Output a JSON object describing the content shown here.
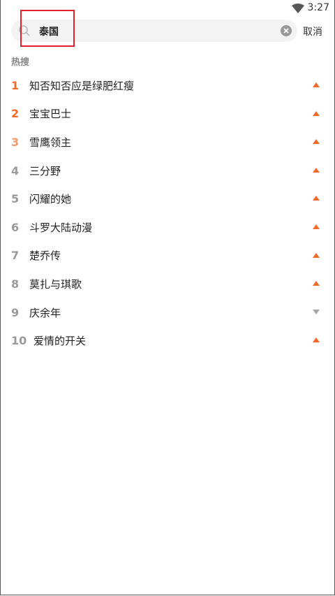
{
  "status": {
    "time": "3:27"
  },
  "search": {
    "value": "泰国",
    "cancel_label": "取消"
  },
  "hot": {
    "title": "热搜",
    "items": [
      {
        "rank": "1",
        "title": "知否知否应是绿肥红瘦",
        "trend": "up"
      },
      {
        "rank": "2",
        "title": "宝宝巴士",
        "trend": "up"
      },
      {
        "rank": "3",
        "title": "雪鹰领主",
        "trend": "up"
      },
      {
        "rank": "4",
        "title": "三分野",
        "trend": "up"
      },
      {
        "rank": "5",
        "title": "闪耀的她",
        "trend": "up"
      },
      {
        "rank": "6",
        "title": "斗罗大陆动漫",
        "trend": "up"
      },
      {
        "rank": "7",
        "title": "楚乔传",
        "trend": "up"
      },
      {
        "rank": "8",
        "title": "莫扎与琪歌",
        "trend": "up"
      },
      {
        "rank": "9",
        "title": "庆余年",
        "trend": "down"
      },
      {
        "rank": "10",
        "title": "爱情的开关",
        "trend": "up"
      }
    ]
  },
  "colors": {
    "accent": "#f06a2a",
    "highlight_box": "#e0202a"
  }
}
